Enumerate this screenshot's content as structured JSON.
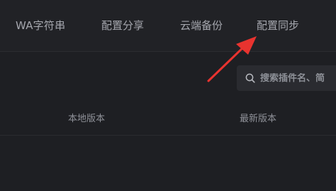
{
  "tabs": [
    {
      "label": "WA字符串"
    },
    {
      "label": "配置分享"
    },
    {
      "label": "云端备份"
    },
    {
      "label": "配置同步"
    }
  ],
  "search": {
    "placeholder": "搜索插件名、简",
    "icon": "search-icon"
  },
  "table": {
    "columns": [
      {
        "label": "本地版本"
      },
      {
        "label": "最新版本"
      }
    ]
  },
  "annotation": {
    "icon": "red-arrow-icon",
    "color": "#e8332f"
  },
  "colors": {
    "background": "#1e1f23",
    "tab_text": "#a5a7ae",
    "search_bg": "#2a2b30"
  }
}
